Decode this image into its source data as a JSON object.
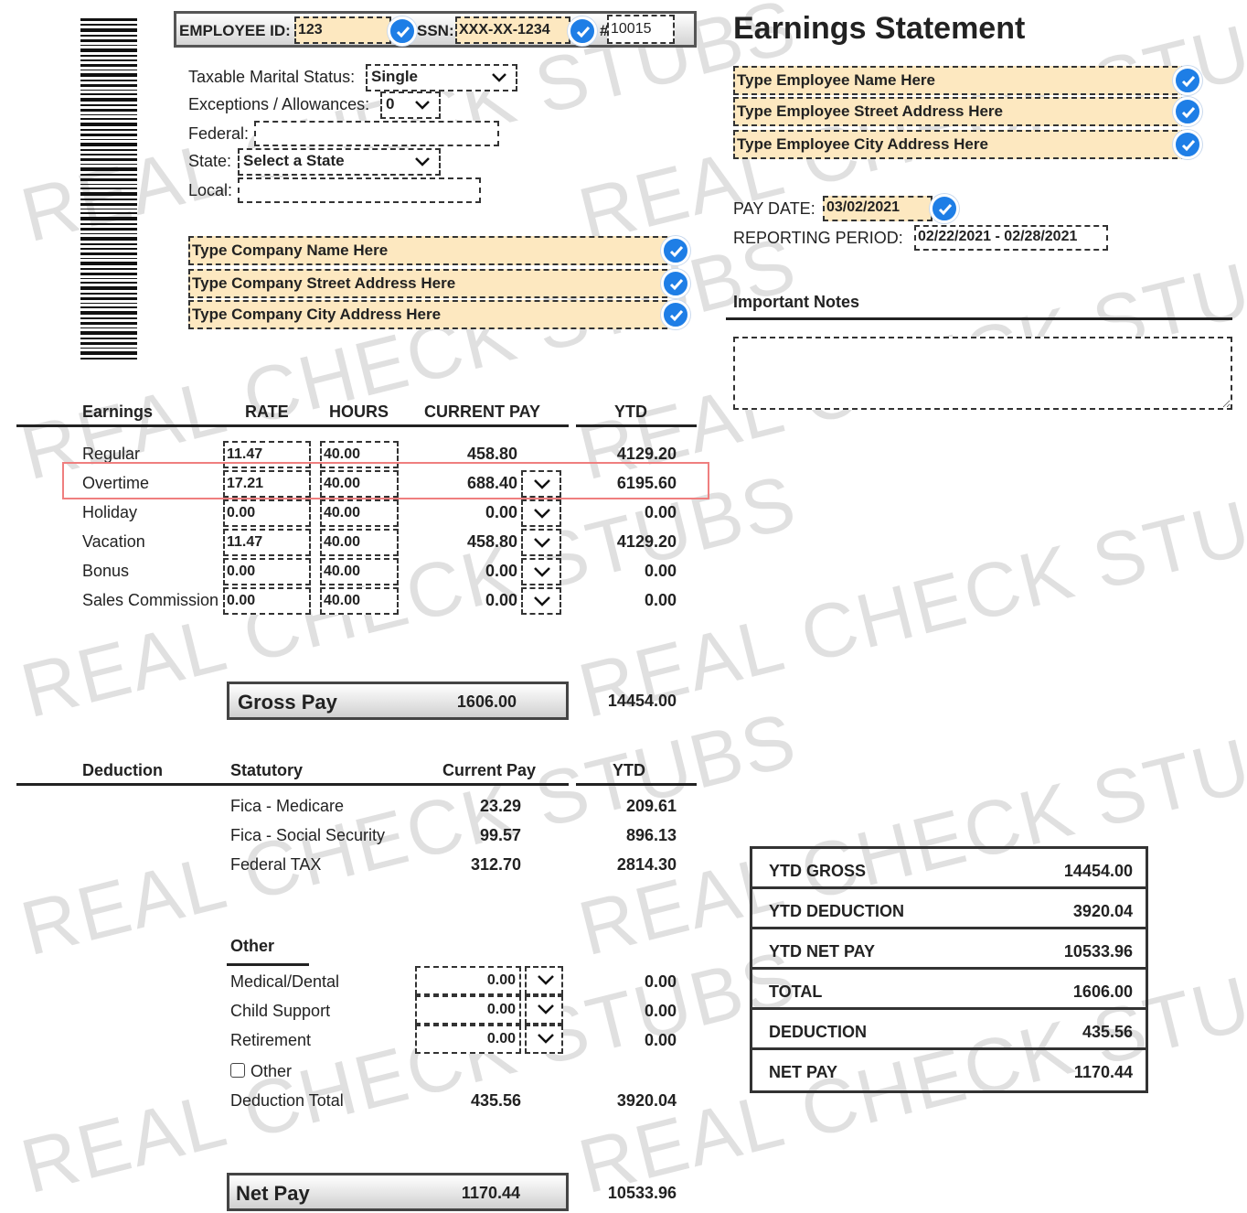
{
  "header": {
    "employee_id_label": "EMPLOYEE ID:",
    "employee_id": "123",
    "ssn_label": "SSN:",
    "ssn": "XXX-XX-1234",
    "check_number_label": "#",
    "check_number": "10015"
  },
  "tax": {
    "marital_label": "Taxable Marital Status:",
    "marital_value": "Single",
    "exceptions_label": "Exceptions / Allowances:",
    "exceptions_value": "0",
    "federal_label": "Federal:",
    "state_label": "State:",
    "state_value": "Select a State",
    "local_label": "Local:"
  },
  "company": {
    "name": "Type Company Name Here",
    "street": "Type Company Street Address Here",
    "city": "Type Company City Address Here"
  },
  "statement": {
    "title": "Earnings Statement",
    "employee_name": "Type Employee Name Here",
    "employee_street": "Type Employee Street Address Here",
    "employee_city": "Type Employee City Address Here",
    "pay_date_label": "PAY DATE:",
    "pay_date": "03/02/2021",
    "period_label": "REPORTING PERIOD:",
    "period": "02/22/2021 - 02/28/2021",
    "notes_label": "Important Notes"
  },
  "earnings": {
    "headers": {
      "earnings": "Earnings",
      "rate": "RATE",
      "hours": "HOURS",
      "current": "CURRENT PAY",
      "ytd": "YTD"
    },
    "rows": [
      {
        "label": "Regular",
        "rate": "11.47",
        "hours": "40.00",
        "current": "458.80",
        "ytd": "4129.20"
      },
      {
        "label": "Overtime",
        "rate": "17.21",
        "hours": "40.00",
        "current": "688.40",
        "ytd": "6195.60"
      },
      {
        "label": "Holiday",
        "rate": "0.00",
        "hours": "40.00",
        "current": "0.00",
        "ytd": "0.00"
      },
      {
        "label": "Vacation",
        "rate": "11.47",
        "hours": "40.00",
        "current": "458.80",
        "ytd": "4129.20"
      },
      {
        "label": "Bonus",
        "rate": "0.00",
        "hours": "40.00",
        "current": "0.00",
        "ytd": "0.00"
      },
      {
        "label": "Sales Commission",
        "rate": "0.00",
        "hours": "40.00",
        "current": "0.00",
        "ytd": "0.00"
      }
    ],
    "gross_label": "Gross Pay",
    "gross_current": "1606.00",
    "gross_ytd": "14454.00"
  },
  "deductions": {
    "headers": {
      "deduction": "Deduction",
      "statutory": "Statutory",
      "current": "Current Pay",
      "ytd": "YTD"
    },
    "statutory": [
      {
        "label": "Fica - Medicare",
        "current": "23.29",
        "ytd": "209.61"
      },
      {
        "label": "Fica - Social Security",
        "current": "99.57",
        "ytd": "896.13"
      },
      {
        "label": "Federal TAX",
        "current": "312.70",
        "ytd": "2814.30"
      }
    ],
    "other_header": "Other",
    "other": [
      {
        "label": "Medical/Dental",
        "current": "0.00",
        "ytd": "0.00"
      },
      {
        "label": "Child Support",
        "current": "0.00",
        "ytd": "0.00"
      },
      {
        "label": "Retirement",
        "current": "0.00",
        "ytd": "0.00"
      }
    ],
    "other_checkbox_label": "Other",
    "total_label": "Deduction Total",
    "total_current": "435.56",
    "total_ytd": "3920.04"
  },
  "netpay": {
    "label": "Net Pay",
    "current": "1170.44",
    "ytd": "10533.96"
  },
  "summary": [
    {
      "label": "YTD GROSS",
      "value": "14454.00"
    },
    {
      "label": "YTD DEDUCTION",
      "value": "3920.04"
    },
    {
      "label": "YTD NET PAY",
      "value": "10533.96"
    },
    {
      "label": "TOTAL",
      "value": "1606.00"
    },
    {
      "label": "DEDUCTION",
      "value": "435.56"
    },
    {
      "label": "NET PAY",
      "value": "1170.44"
    }
  ],
  "watermark": {
    "text": "REAL CHECK STUBS"
  },
  "colors": {
    "highlight": "#fde8c0",
    "check_blue": "#1e7ee6",
    "selection_red": "#ef7f7f"
  }
}
